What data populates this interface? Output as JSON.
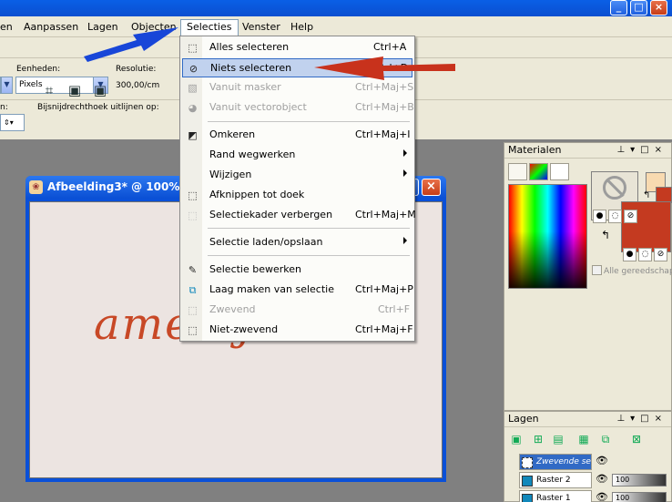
{
  "menubar": {
    "items": [
      "en",
      "Aanpassen",
      "Lagen",
      "Objecten",
      "Selecties",
      "Venster",
      "Help"
    ]
  },
  "toolbar": {
    "units_label": "Eenheden:",
    "units_value": "Pixels",
    "resolution_label": "Resolutie:",
    "resolution_value": "300,00/cm",
    "left_label": "n:",
    "crop_align_label": "Bijsnijdrechthoek uitlijnen op:"
  },
  "image_window": {
    "title": "Afbeelding3* @ 100% (Z",
    "canvas_text": "amen j r a"
  },
  "materials": {
    "title": "Materialen",
    "checkbox_label": "Alle gereedschap"
  },
  "layers": {
    "title": "Lagen",
    "rows": [
      {
        "name": "Zwevende se",
        "opacity": ""
      },
      {
        "name": "Raster 2",
        "opacity": "100"
      },
      {
        "name": "Raster 1",
        "opacity": "100"
      }
    ]
  },
  "selecties_menu": {
    "items": [
      {
        "label": "Alles selecteren",
        "shortcut": "Ctrl+A"
      },
      {
        "label": "Niets selecteren",
        "shortcut": "Ctrl+D"
      },
      {
        "label": "Vanuit masker",
        "shortcut": "Ctrl+Maj+S"
      },
      {
        "label": "Vanuit vectorobject",
        "shortcut": "Ctrl+Maj+B"
      },
      {
        "label": "Omkeren",
        "shortcut": "Ctrl+Maj+I"
      },
      {
        "label": "Rand wegwerken",
        "shortcut": ""
      },
      {
        "label": "Wijzigen",
        "shortcut": ""
      },
      {
        "label": "Afknippen tot doek",
        "shortcut": ""
      },
      {
        "label": "Selectiekader verbergen",
        "shortcut": "Ctrl+Maj+M"
      },
      {
        "label": "Selectie laden/opslaan",
        "shortcut": ""
      },
      {
        "label": "Selectie bewerken",
        "shortcut": ""
      },
      {
        "label": "Laag maken van selectie",
        "shortcut": "Ctrl+Maj+P"
      },
      {
        "label": "Zwevend",
        "shortcut": "Ctrl+F"
      },
      {
        "label": "Niet-zwevend",
        "shortcut": "Ctrl+Maj+F"
      }
    ]
  },
  "colors": {
    "menu_highlight": "#c1d2ee",
    "foreground_swatch": "#c43a20",
    "blue_arrow": "#1846d8",
    "red_arrow": "#c8321c"
  }
}
